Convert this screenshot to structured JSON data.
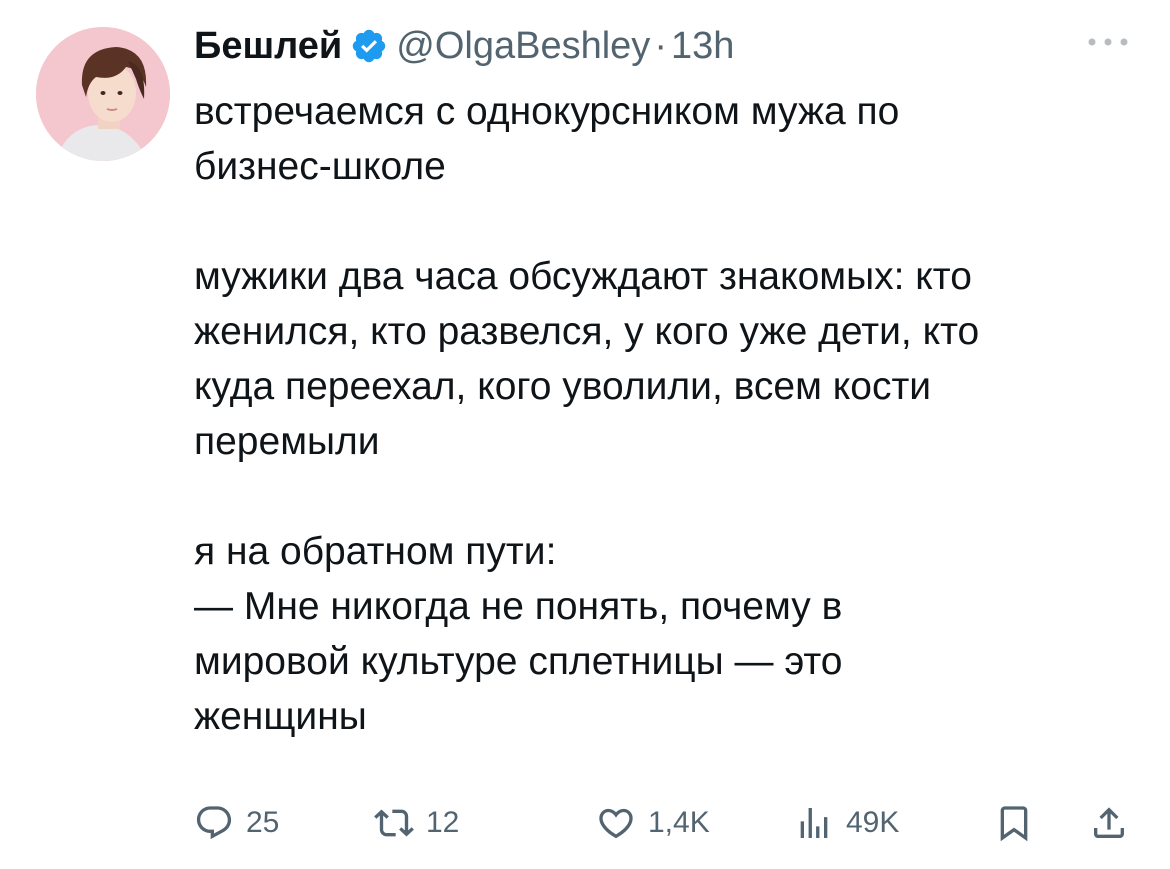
{
  "tweet": {
    "author": {
      "name": "Бешлей",
      "handle": "@OlgaBeshley",
      "separator": "·",
      "time": "13h"
    },
    "text_lines": [
      "встречаемся с однокурсником мужа по",
      "бизнес-школе",
      "мужики два часа обсуждают знакомых: кто",
      "женился, кто развелся, у кого уже дети, кто",
      "куда переехал, кого уволили, всем кости",
      "перемыли",
      "я на обратном пути:",
      "— Мне никогда не понять, почему в",
      "мировой культуре сплетницы — это",
      "женщины"
    ],
    "actions": {
      "replies": "25",
      "retweets": "12",
      "likes": "1,4K",
      "views": "49K"
    }
  },
  "icons": {
    "verified": "verified-badge-icon",
    "more": "more-options-icon",
    "reply": "reply-icon",
    "retweet": "retweet-icon",
    "like": "heart-icon",
    "views": "views-icon",
    "bookmark": "bookmark-icon",
    "share": "share-icon"
  },
  "colors": {
    "text": "#0f1419",
    "secondary": "#536471",
    "verified": "#1d9bf0"
  }
}
